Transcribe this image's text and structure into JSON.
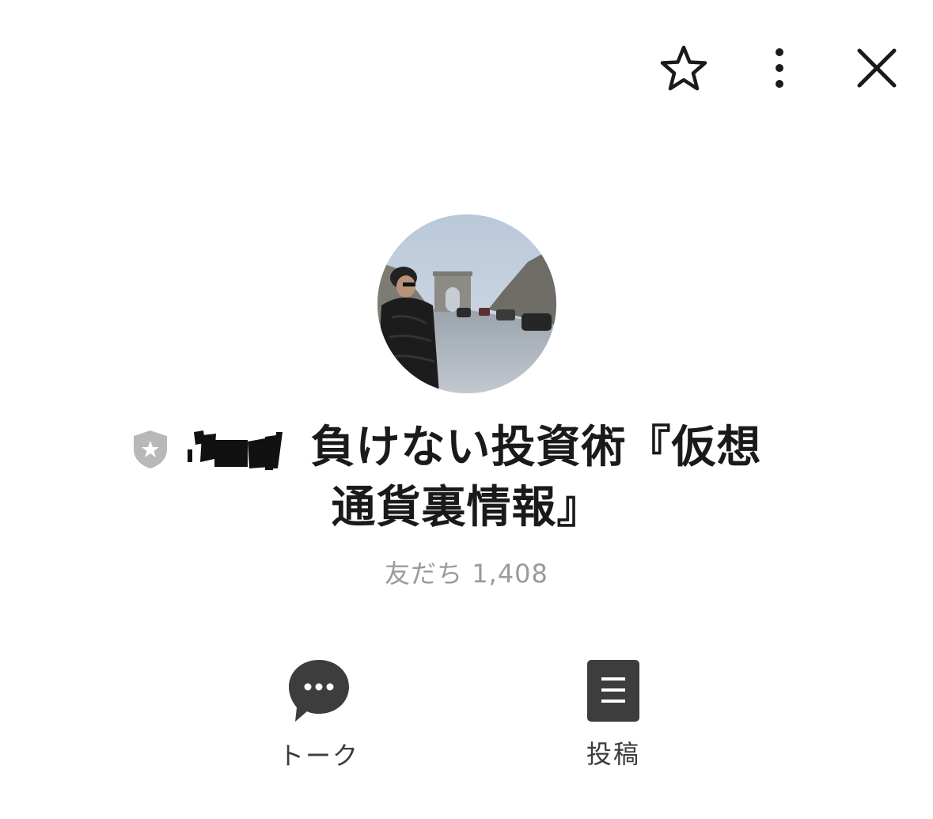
{
  "profile": {
    "name_line1": "負けない投資術『仮想",
    "name_line2": "通貨裏情報』",
    "friends_label": "友だち",
    "friends_count": "1,408"
  },
  "actions": {
    "talk_label": "トーク",
    "post_label": "投稿"
  },
  "colors": {
    "icon_dark": "#3d3d3d",
    "badge_gray": "#b8b8b8",
    "secondary_text": "#9a9a9a"
  },
  "icons": {
    "star": "star-icon",
    "more": "more-vertical-icon",
    "close": "close-icon",
    "talk": "chat-bubble-icon",
    "post": "post-list-icon",
    "badge": "shield-star-icon"
  }
}
